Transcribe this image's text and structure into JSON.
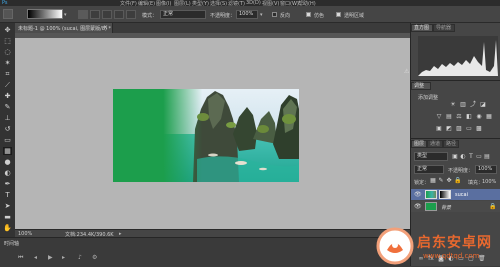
{
  "menubar": {
    "items": [
      "文件(F)",
      "编辑(E)",
      "图像(I)",
      "图层(L)",
      "类型(Y)",
      "选择(S)",
      "滤镜(T)",
      "3D(D)",
      "视图(V)",
      "窗口(W)",
      "帮助(H)"
    ]
  },
  "options": {
    "mode_label": "模式：",
    "mode_value": "正常",
    "opacity_label": "不透明度：",
    "opacity_value": "100%",
    "reverse_label": "反向",
    "dither_label": "仿色",
    "transparency_label": "透明区域"
  },
  "document": {
    "tab_title": "未标题-1 @ 100% (sucai, 图层蒙版/8) *",
    "zoom": "100%",
    "doc_info": "文档:234.4K/390.6K"
  },
  "timeline": {
    "label": "时间轴"
  },
  "histogram_panel": {
    "tabs": [
      "直方图",
      "导航器"
    ]
  },
  "adjustments_panel": {
    "title": "调整",
    "subtitle": "添加调整"
  },
  "layers_panel": {
    "tabs": [
      "图层",
      "通道",
      "路径"
    ],
    "filter_kind": "类型",
    "blend_mode": "正常",
    "opacity_label": "不透明度：",
    "opacity_value": "100%",
    "lock_label": "锁定：",
    "fill_label": "填充：",
    "fill_value": "100%",
    "layers": [
      {
        "name": "sucai",
        "selected": true
      },
      {
        "name": "背景",
        "selected": false
      }
    ]
  },
  "watermark": {
    "brand": "启东安卓网",
    "url": "www.qdtqd.com"
  },
  "colors": {
    "canvas_bg": "#b5b5b5",
    "green_fill": "#1c9e4c",
    "panel_bg": "#464646",
    "selected_layer": "#5a6fa0"
  }
}
